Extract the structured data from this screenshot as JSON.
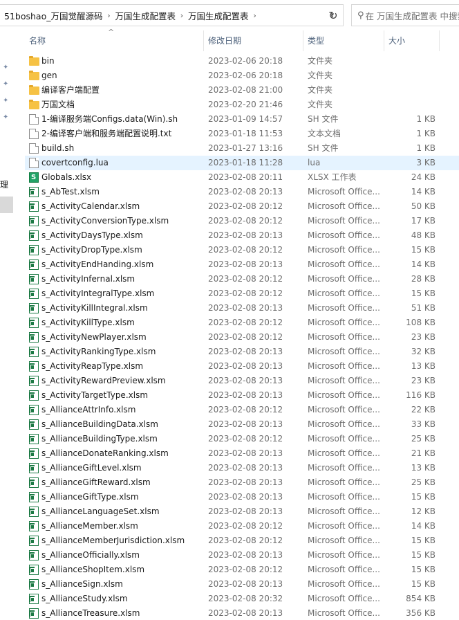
{
  "breadcrumbs": [
    "51boshao_万国觉醒源码",
    "万国生成配置表",
    "万国生成配置表"
  ],
  "search": {
    "placeholder": "在 万国生成配置表 中搜索"
  },
  "nav": {
    "partial_label": "管理"
  },
  "columns": {
    "name": "名称",
    "date": "修改日期",
    "type": "类型",
    "size": "大小"
  },
  "files": [
    {
      "name": "bin",
      "date": "2023-02-06 20:18",
      "type": "文件夹",
      "size": "",
      "icon": "folder-icon"
    },
    {
      "name": "gen",
      "date": "2023-02-06 20:18",
      "type": "文件夹",
      "size": "",
      "icon": "folder-icon"
    },
    {
      "name": "编译客户端配置",
      "date": "2023-02-08 21:00",
      "type": "文件夹",
      "size": "",
      "icon": "folder-icon"
    },
    {
      "name": "万国文档",
      "date": "2023-02-20 21:46",
      "type": "文件夹",
      "size": "",
      "icon": "folder-icon"
    },
    {
      "name": "1-编译服务端Configs.data(Win).sh",
      "date": "2023-01-09 14:57",
      "type": "SH 文件",
      "size": "1 KB",
      "icon": "file-icon"
    },
    {
      "name": "2-编译客户端和服务端配置说明.txt",
      "date": "2023-01-18 11:53",
      "type": "文本文档",
      "size": "1 KB",
      "icon": "file-icon"
    },
    {
      "name": "build.sh",
      "date": "2023-01-27 13:16",
      "type": "SH 文件",
      "size": "1 KB",
      "icon": "file-icon"
    },
    {
      "name": "covertconfig.lua",
      "date": "2023-01-18 11:28",
      "type": "lua",
      "size": "3 KB",
      "icon": "file-icon",
      "selected": true
    },
    {
      "name": "Globals.xlsx",
      "date": "2023-02-08 20:11",
      "type": "XLSX 工作表",
      "size": "24 KB",
      "icon": "globals-icon"
    },
    {
      "name": "s_AbTest.xlsm",
      "date": "2023-02-08 20:13",
      "type": "Microsoft Office...",
      "size": "14 KB",
      "icon": "excel-icon"
    },
    {
      "name": "s_ActivityCalendar.xlsm",
      "date": "2023-02-08 20:12",
      "type": "Microsoft Office...",
      "size": "50 KB",
      "icon": "excel-icon"
    },
    {
      "name": "s_ActivityConversionType.xlsm",
      "date": "2023-02-08 20:12",
      "type": "Microsoft Office...",
      "size": "17 KB",
      "icon": "excel-icon"
    },
    {
      "name": "s_ActivityDaysType.xlsm",
      "date": "2023-02-08 20:13",
      "type": "Microsoft Office...",
      "size": "48 KB",
      "icon": "excel-icon"
    },
    {
      "name": "s_ActivityDropType.xlsm",
      "date": "2023-02-08 20:12",
      "type": "Microsoft Office...",
      "size": "15 KB",
      "icon": "excel-icon"
    },
    {
      "name": "s_ActivityEndHanding.xlsm",
      "date": "2023-02-08 20:13",
      "type": "Microsoft Office...",
      "size": "14 KB",
      "icon": "excel-icon"
    },
    {
      "name": "s_ActivityInfernal.xlsm",
      "date": "2023-02-08 20:12",
      "type": "Microsoft Office...",
      "size": "28 KB",
      "icon": "excel-icon"
    },
    {
      "name": "s_ActivityIntegralType.xlsm",
      "date": "2023-02-08 20:12",
      "type": "Microsoft Office...",
      "size": "15 KB",
      "icon": "excel-icon"
    },
    {
      "name": "s_ActivityKillIntegral.xlsm",
      "date": "2023-02-08 20:13",
      "type": "Microsoft Office...",
      "size": "51 KB",
      "icon": "excel-icon"
    },
    {
      "name": "s_ActivityKillType.xlsm",
      "date": "2023-02-08 20:12",
      "type": "Microsoft Office...",
      "size": "108 KB",
      "icon": "excel-icon"
    },
    {
      "name": "s_ActivityNewPlayer.xlsm",
      "date": "2023-02-08 20:12",
      "type": "Microsoft Office...",
      "size": "23 KB",
      "icon": "excel-icon"
    },
    {
      "name": "s_ActivityRankingType.xlsm",
      "date": "2023-02-08 20:13",
      "type": "Microsoft Office...",
      "size": "32 KB",
      "icon": "excel-icon"
    },
    {
      "name": "s_ActivityReapType.xlsm",
      "date": "2023-02-08 20:13",
      "type": "Microsoft Office...",
      "size": "13 KB",
      "icon": "excel-icon"
    },
    {
      "name": "s_ActivityRewardPreview.xlsm",
      "date": "2023-02-08 20:13",
      "type": "Microsoft Office...",
      "size": "23 KB",
      "icon": "excel-icon"
    },
    {
      "name": "s_ActivityTargetType.xlsm",
      "date": "2023-02-08 20:13",
      "type": "Microsoft Office...",
      "size": "116 KB",
      "icon": "excel-icon"
    },
    {
      "name": "s_AllianceAttrInfo.xlsm",
      "date": "2023-02-08 20:12",
      "type": "Microsoft Office...",
      "size": "22 KB",
      "icon": "excel-icon"
    },
    {
      "name": "s_AllianceBuildingData.xlsm",
      "date": "2023-02-08 20:13",
      "type": "Microsoft Office...",
      "size": "33 KB",
      "icon": "excel-icon"
    },
    {
      "name": "s_AllianceBuildingType.xlsm",
      "date": "2023-02-08 20:12",
      "type": "Microsoft Office...",
      "size": "25 KB",
      "icon": "excel-icon"
    },
    {
      "name": "s_AllianceDonateRanking.xlsm",
      "date": "2023-02-08 20:13",
      "type": "Microsoft Office...",
      "size": "21 KB",
      "icon": "excel-icon"
    },
    {
      "name": "s_AllianceGiftLevel.xlsm",
      "date": "2023-02-08 20:13",
      "type": "Microsoft Office...",
      "size": "13 KB",
      "icon": "excel-icon"
    },
    {
      "name": "s_AllianceGiftReward.xlsm",
      "date": "2023-02-08 20:13",
      "type": "Microsoft Office...",
      "size": "25 KB",
      "icon": "excel-icon"
    },
    {
      "name": "s_AllianceGiftType.xlsm",
      "date": "2023-02-08 20:13",
      "type": "Microsoft Office...",
      "size": "15 KB",
      "icon": "excel-icon"
    },
    {
      "name": "s_AllianceLanguageSet.xlsm",
      "date": "2023-02-08 20:13",
      "type": "Microsoft Office...",
      "size": "12 KB",
      "icon": "excel-icon"
    },
    {
      "name": "s_AllianceMember.xlsm",
      "date": "2023-02-08 20:12",
      "type": "Microsoft Office...",
      "size": "14 KB",
      "icon": "excel-icon"
    },
    {
      "name": "s_AllianceMemberJurisdiction.xlsm",
      "date": "2023-02-08 20:12",
      "type": "Microsoft Office...",
      "size": "15 KB",
      "icon": "excel-icon"
    },
    {
      "name": "s_AllianceOfficially.xlsm",
      "date": "2023-02-08 20:13",
      "type": "Microsoft Office...",
      "size": "15 KB",
      "icon": "excel-icon"
    },
    {
      "name": "s_AllianceShopItem.xlsm",
      "date": "2023-02-08 20:12",
      "type": "Microsoft Office...",
      "size": "15 KB",
      "icon": "excel-icon"
    },
    {
      "name": "s_AllianceSign.xlsm",
      "date": "2023-02-08 20:13",
      "type": "Microsoft Office...",
      "size": "15 KB",
      "icon": "excel-icon"
    },
    {
      "name": "s_AllianceStudy.xlsm",
      "date": "2023-02-08 20:32",
      "type": "Microsoft Office...",
      "size": "854 KB",
      "icon": "excel-icon"
    },
    {
      "name": "s_AllianceTreasure.xlsm",
      "date": "2023-02-08 20:13",
      "type": "Microsoft Office...",
      "size": "356 KB",
      "icon": "excel-icon"
    }
  ]
}
